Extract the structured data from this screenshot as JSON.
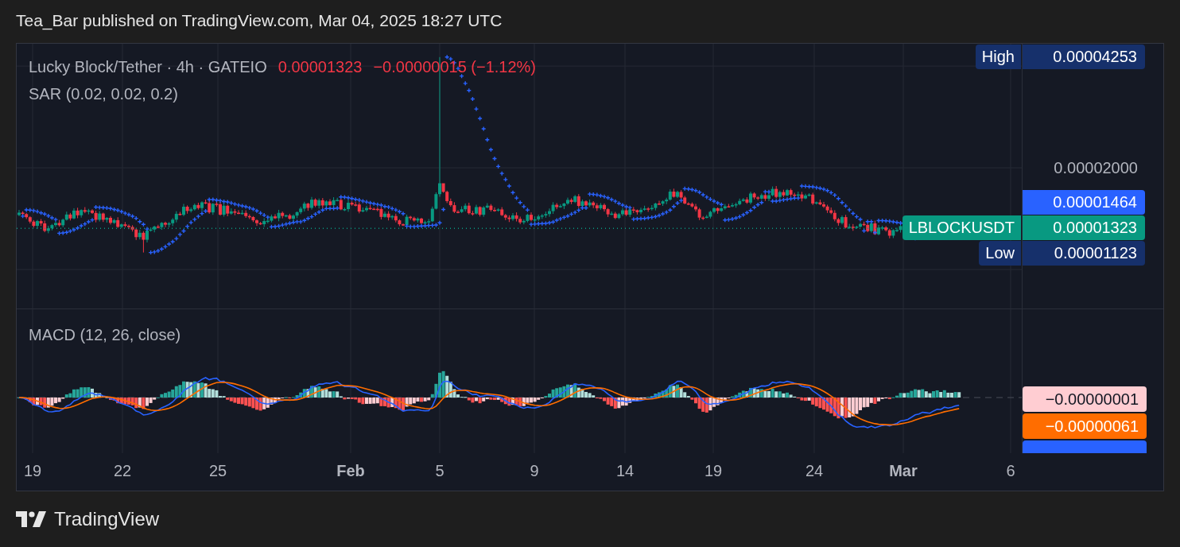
{
  "header": {
    "text": "Tea_Bar published on TradingView.com, Mar 04, 2025 18:27 UTC"
  },
  "legend": {
    "title": "Lucky Block/Tether · 4h · GATEIO",
    "price": "0.00001323",
    "change": "−0.00000015 (−1.12%)"
  },
  "indicators": [
    {
      "text": "SAR (0.02, 0.02, 0.2)"
    }
  ],
  "price_axis": {
    "labels": [
      "0.00002000"
    ]
  },
  "price_tags": [
    {
      "kind": "high",
      "label": "High",
      "value": "0.00004253",
      "color": "#16306b"
    },
    {
      "kind": "sar",
      "value": "0.00001464",
      "color": "#2962ff"
    },
    {
      "kind": "last",
      "label": "LBLOCKUSDT",
      "value": "0.00001323",
      "color": "#089981"
    },
    {
      "kind": "low",
      "label": "Low",
      "value": "0.00001123",
      "color": "#16306b"
    }
  ],
  "macd_pane": {
    "title": "MACD (12, 26, close)",
    "tags": [
      {
        "value": "−0.00000001",
        "color": "#ffcdd2"
      },
      {
        "value": "−0.00000061",
        "color": "#ff6d00"
      },
      {
        "color": "#2962ff"
      }
    ]
  },
  "time_axis": [
    {
      "text": "19",
      "major": false
    },
    {
      "text": "22",
      "major": false
    },
    {
      "text": "25",
      "major": false
    },
    {
      "text": "Feb",
      "major": true
    },
    {
      "text": "5",
      "major": false
    },
    {
      "text": "9",
      "major": false
    },
    {
      "text": "14",
      "major": false
    },
    {
      "text": "19",
      "major": false
    },
    {
      "text": "24",
      "major": false
    },
    {
      "text": "Mar",
      "major": true
    },
    {
      "text": "6",
      "major": false
    }
  ],
  "footer": {
    "brand": "TradingView"
  }
}
